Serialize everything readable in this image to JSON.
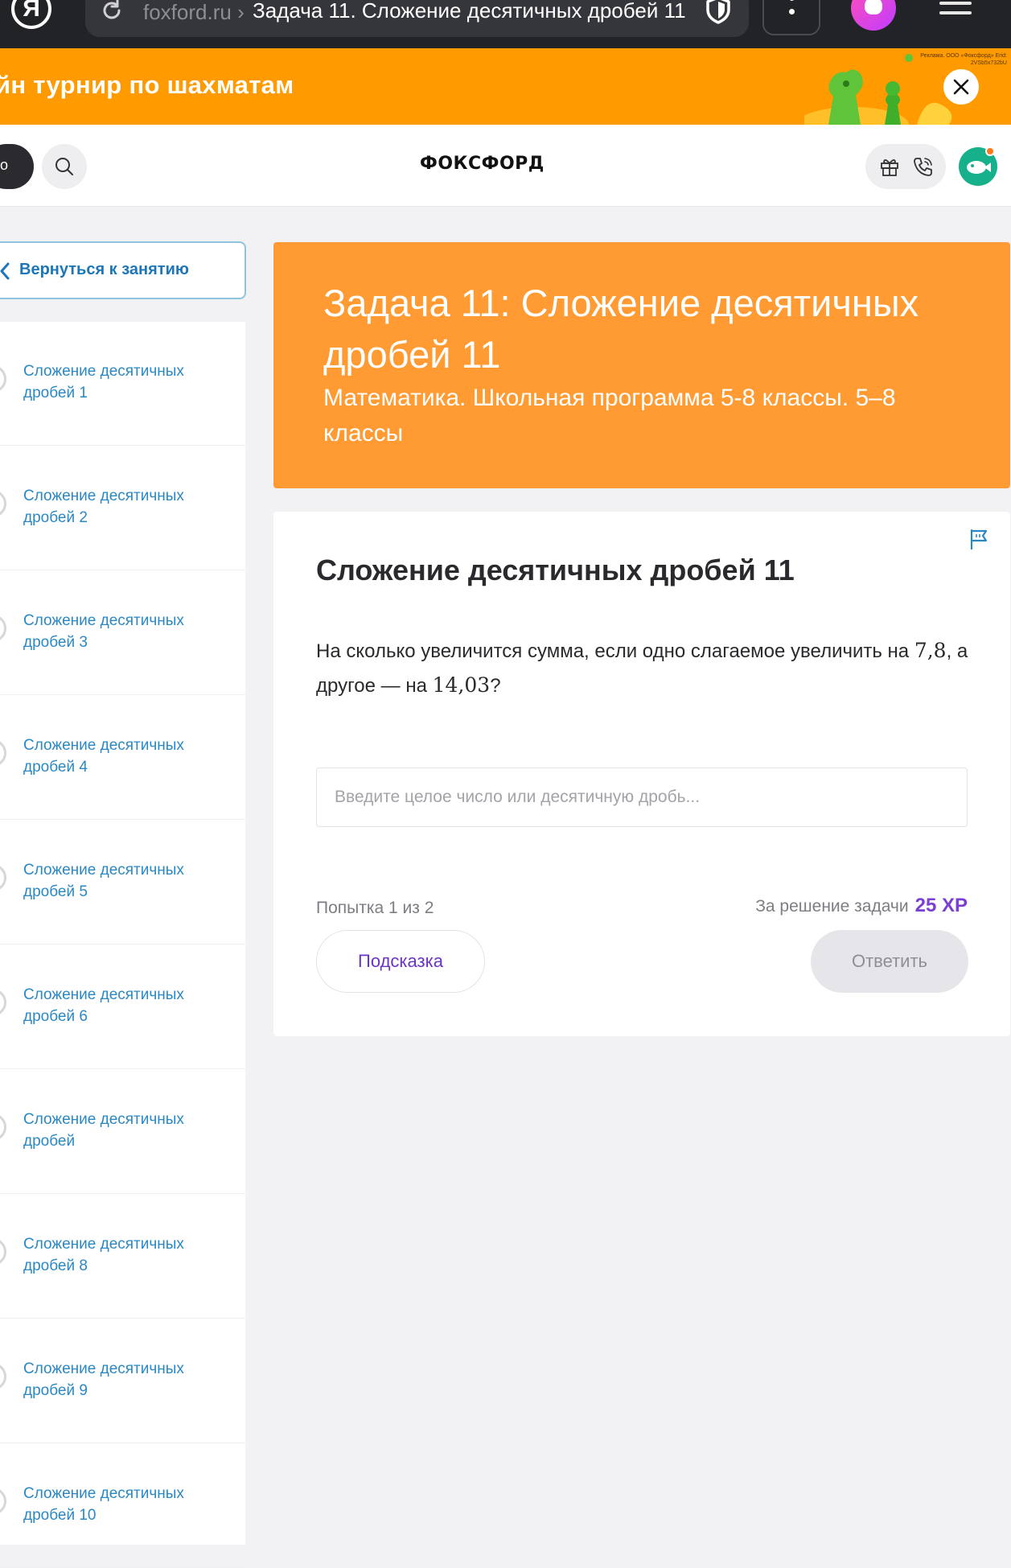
{
  "browser": {
    "logo_letter": "Я",
    "domain": "foxford.ru",
    "separator": "›",
    "tab_title": "Задача 11. Сложение десятичных дробей 11 -",
    "icons": [
      "reload-icon",
      "shield-icon",
      "more-vert-icon",
      "alice-icon",
      "hamburger-icon"
    ]
  },
  "ad": {
    "text": "йн турнир по шахматам",
    "disclaimer": "Реклама. ООО «Фоксфорд» Erid: 2VSb5x732bU",
    "close_icon": "close-icon",
    "color": "#ff9a00"
  },
  "header": {
    "login_label": "о",
    "logo": "ФОКСФОРД",
    "icons": [
      "search-icon",
      "gift-icon",
      "phone-icon",
      "avatar"
    ]
  },
  "sidebar": {
    "back_label": "Вернуться к занятию",
    "items": [
      {
        "label": "Сложение десятичных дробей 1"
      },
      {
        "label": "Сложение десятичных дробей 2"
      },
      {
        "label": "Сложение десятичных дробей 3"
      },
      {
        "label": "Сложение десятичных дробей 4"
      },
      {
        "label": "Сложение десятичных дробей 5"
      },
      {
        "label": "Сложение десятичных дробей 6"
      },
      {
        "label": "Сложение десятичных дробей"
      },
      {
        "label": "Сложение десятичных дробей 8"
      },
      {
        "label": "Сложение десятичных дробей 9"
      },
      {
        "label": "Сложение десятичных дробей 10"
      }
    ]
  },
  "task_header": {
    "title": "Задача 11: Сложение десятичных дробей 11",
    "subtitle": "Математика. Школьная программа 5-8 классы. 5–8 классы",
    "color": "#ff9b32"
  },
  "task": {
    "title": "Сложение десятичных дробей 11",
    "question_part1": "На сколько увеличится сумма, если одно слагаемое увеличить на ",
    "value_a": "7,8",
    "question_part2": ", а другое — на ",
    "value_b": "14,03",
    "question_part3": "?",
    "input_placeholder": "Введите целое число или десятичную дробь...",
    "input_value": "",
    "attempt": "Попытка 1 из 2",
    "reward_label": "За решение задачи",
    "reward_xp": "25 XP",
    "hint_label": "Подсказка",
    "submit_label": "Ответить",
    "accent_color": "#7b3fd2"
  }
}
